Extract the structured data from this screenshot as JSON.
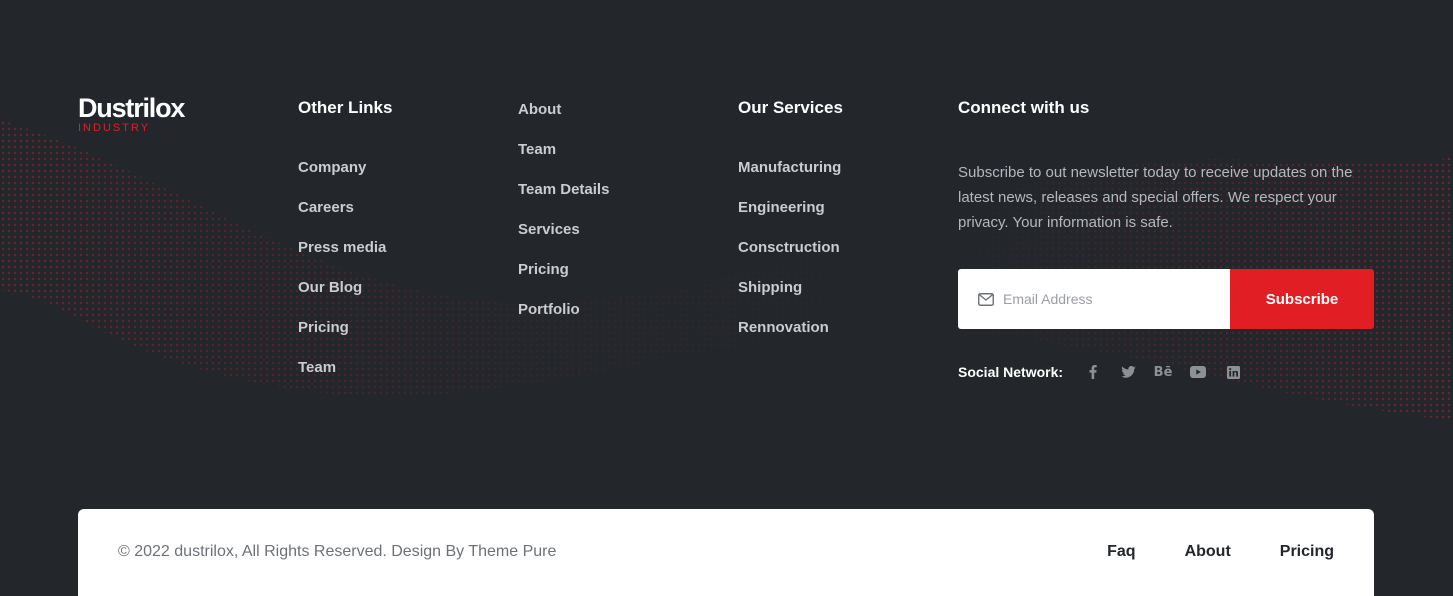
{
  "brand": {
    "name": "Dustrilox",
    "tagline": "INDUSTRY",
    "accent": "#e21e25",
    "background": "#23272b"
  },
  "other_links": {
    "title": "Other Links",
    "items": [
      "Company",
      "Careers",
      "Press media",
      "Our Blog",
      "Pricing",
      "Team"
    ]
  },
  "quick_links": {
    "items": [
      "About",
      "Team",
      "Team Details",
      "Services",
      "Pricing",
      "Portfolio"
    ]
  },
  "services": {
    "title": "Our Services",
    "items": [
      "Manufacturing",
      "Engineering",
      "Consctruction",
      "Shipping",
      "Rennovation"
    ]
  },
  "connect": {
    "title": "Connect with us",
    "text": "Subscribe to out newsletter today to receive updates on the latest news, releases and special offers. We respect your privacy. Your information is safe.",
    "email_placeholder": "Email Address",
    "subscribe_label": "Subscribe",
    "social_label": "Social Network:",
    "social_icons": [
      "facebook-icon",
      "twitter-icon",
      "behance-icon",
      "youtube-icon",
      "linkedin-icon"
    ]
  },
  "bottom": {
    "copyright": "© 2022 dustrilox, All Rights Reserved. Design By Theme Pure",
    "links": [
      "Faq",
      "About",
      "Pricing"
    ]
  }
}
